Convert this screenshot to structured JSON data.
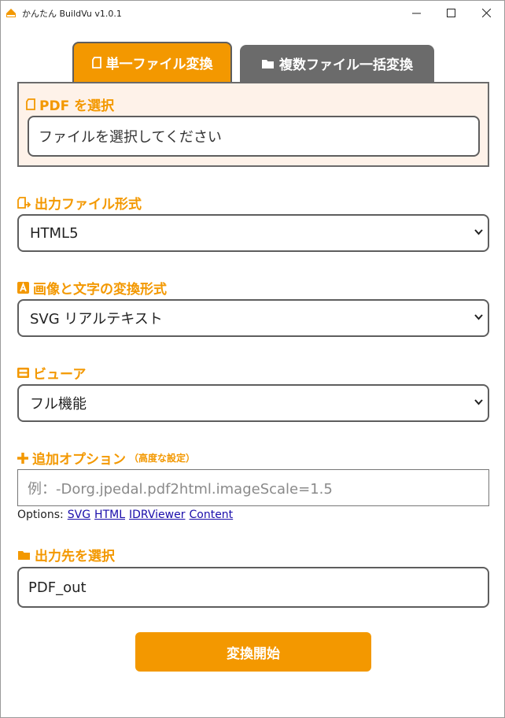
{
  "window": {
    "title": "かんたん BuildVu v1.0.1"
  },
  "tabs": {
    "single": "単一ファイル変換",
    "batch": "複数ファイル一括変換"
  },
  "pdf_select": {
    "label": "PDF を選択",
    "placeholder": "ファイルを選択してください"
  },
  "output_format": {
    "label": "出力ファイル形式",
    "value": "HTML5"
  },
  "text_mode": {
    "label": "画像と文字の変換形式",
    "value": "SVG リアルテキスト"
  },
  "viewer": {
    "label": "ビューア",
    "value": "フル機能"
  },
  "extra_options": {
    "label": "追加オプション",
    "note": "（高度な設定）",
    "placeholder": "例：-Dorg.jpedal.pdf2html.imageScale=1.5",
    "links_prefix": "Options:",
    "links": [
      "SVG",
      "HTML",
      "IDRViewer",
      "Content"
    ]
  },
  "output_dir": {
    "label": "出力先を選択",
    "value": "PDF_out"
  },
  "start_button": "変換開始",
  "colors": {
    "accent": "#f39800",
    "tab_inactive": "#6b6b6b",
    "panel_bg": "#fef2e9",
    "link": "#1a0dab"
  }
}
